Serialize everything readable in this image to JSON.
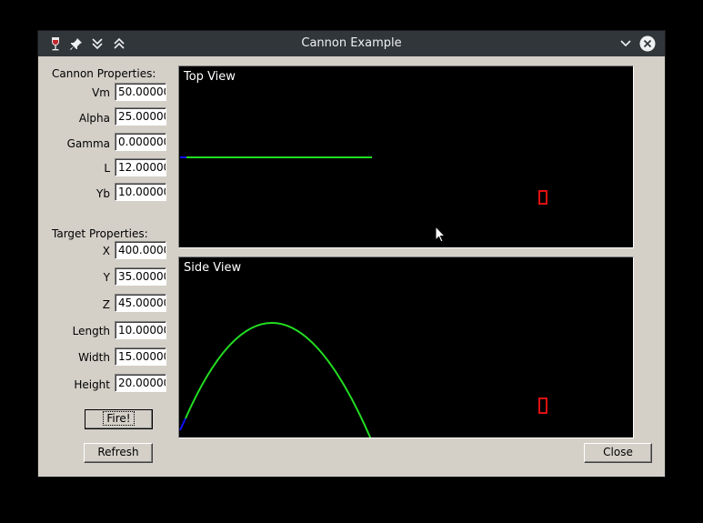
{
  "window": {
    "title": "Cannon Example"
  },
  "cannon": {
    "heading": "Cannon Properties:",
    "fields": [
      {
        "label": "Vm",
        "value": "50.000000"
      },
      {
        "label": "Alpha",
        "value": "25.000000"
      },
      {
        "label": "Gamma",
        "value": "0.000000"
      },
      {
        "label": "L",
        "value": "12.000000"
      },
      {
        "label": "Yb",
        "value": "10.000000"
      }
    ]
  },
  "target": {
    "heading": "Target Properties:",
    "fields": [
      {
        "label": "X",
        "value": "400.000000"
      },
      {
        "label": "Y",
        "value": "35.000000"
      },
      {
        "label": "Z",
        "value": "45.000000"
      },
      {
        "label": "Length",
        "value": "10.000000"
      },
      {
        "label": "Width",
        "value": "15.000000"
      },
      {
        "label": "Height",
        "value": "20.000000"
      }
    ]
  },
  "buttons": {
    "fire": "Fire!",
    "refresh": "Refresh",
    "close": "Close"
  },
  "views": {
    "top": "Top View",
    "side": "Side View"
  },
  "colors": {
    "trajectory": "#22dd22",
    "cannon": "#1010ff",
    "target": "#e01010",
    "titlebar": "#31363b"
  },
  "icons": {
    "app": "wine-glass-icon",
    "pin": "pin-icon",
    "keep-below": "double-chevron-down-icon",
    "keep-above": "double-chevron-up-icon",
    "minimize": "chevron-down-icon",
    "close": "close-circle-icon"
  }
}
